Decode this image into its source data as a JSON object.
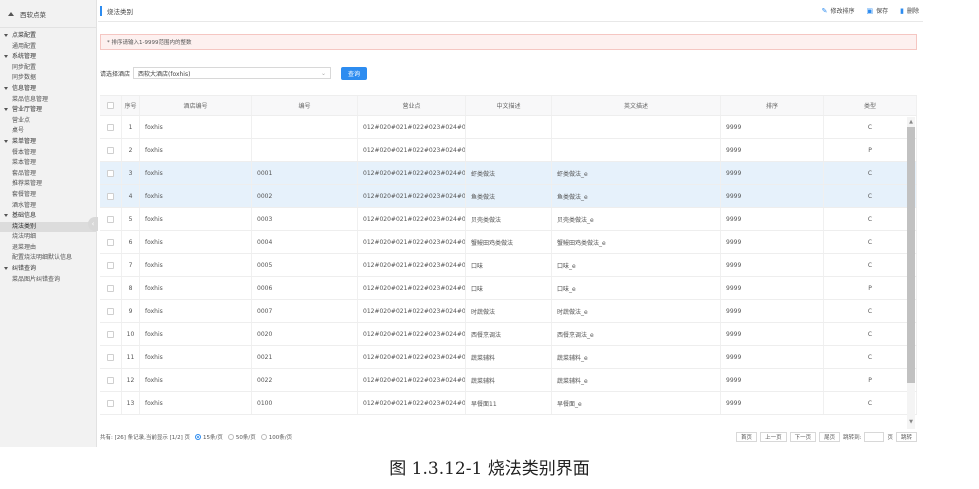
{
  "sidebar": {
    "brand": "西软点菜",
    "items": [
      {
        "label": "点菜配置",
        "type": "group"
      },
      {
        "label": "通用配置",
        "type": "sub"
      },
      {
        "label": "系统管理",
        "type": "group"
      },
      {
        "label": "同步配置",
        "type": "sub"
      },
      {
        "label": "同步数据",
        "type": "sub"
      },
      {
        "label": "信息管理",
        "type": "group"
      },
      {
        "label": "菜品信息管理",
        "type": "sub"
      },
      {
        "label": "营业厅管理",
        "type": "group"
      },
      {
        "label": "营业点",
        "type": "sub"
      },
      {
        "label": "桌号",
        "type": "sub"
      },
      {
        "label": "菜单管理",
        "type": "group"
      },
      {
        "label": "餐本管理",
        "type": "sub"
      },
      {
        "label": "菜本管理",
        "type": "sub"
      },
      {
        "label": "套品管理",
        "type": "sub"
      },
      {
        "label": "推荐菜管理",
        "type": "sub"
      },
      {
        "label": "套餐管理",
        "type": "sub"
      },
      {
        "label": "酒水管理",
        "type": "sub"
      },
      {
        "label": "基础信息",
        "type": "group"
      },
      {
        "label": "烧法类别",
        "type": "sub",
        "active": true
      },
      {
        "label": "烧法明细",
        "type": "sub"
      },
      {
        "label": "退菜理由",
        "type": "sub"
      },
      {
        "label": "配置烧法明细默认信息",
        "type": "sub"
      },
      {
        "label": "纠错查询",
        "type": "group"
      },
      {
        "label": "菜品图片纠错查询",
        "type": "sub"
      }
    ]
  },
  "header": {
    "title": "烧法类别",
    "actions": {
      "sort": "修改排序",
      "save": "保存",
      "delete": "删除"
    }
  },
  "notice": "* 排序请输入1-9999范围内的整数",
  "filter": {
    "label": "请选择酒店",
    "selected": "西软大酒店(foxhis)",
    "query": "查询"
  },
  "table": {
    "columns": [
      "序号",
      "酒店编号",
      "编号",
      "营业点",
      "中文描述",
      "英文描述",
      "排序",
      "类型"
    ],
    "rows": [
      {
        "no": "1",
        "hotel": "foxhis",
        "code": "",
        "point": "012#020#021#022#023#024#02...",
        "cn": "",
        "en": "",
        "sort": "9999",
        "type": "C",
        "hl": false
      },
      {
        "no": "2",
        "hotel": "foxhis",
        "code": "",
        "point": "012#020#021#022#023#024#02...",
        "cn": "",
        "en": "",
        "sort": "9999",
        "type": "P",
        "hl": false
      },
      {
        "no": "3",
        "hotel": "foxhis",
        "code": "0001",
        "point": "012#020#021#022#023#024#02...",
        "cn": "虾类做法",
        "en": "虾类做法_e",
        "sort": "9999",
        "type": "C",
        "hl": true
      },
      {
        "no": "4",
        "hotel": "foxhis",
        "code": "0002",
        "point": "012#020#021#022#023#024#02...",
        "cn": "鱼类做法",
        "en": "鱼类做法_e",
        "sort": "9999",
        "type": "C",
        "hl": true
      },
      {
        "no": "5",
        "hotel": "foxhis",
        "code": "0003",
        "point": "012#020#021#022#023#024#02...",
        "cn": "贝壳类做法",
        "en": "贝壳类做法_e",
        "sort": "9999",
        "type": "C",
        "hl": false
      },
      {
        "no": "6",
        "hotel": "foxhis",
        "code": "0004",
        "point": "012#020#021#022#023#024#02...",
        "cn": "蟹鳗田鸡类做法",
        "en": "蟹鳗田鸡类做法_e",
        "sort": "9999",
        "type": "C",
        "hl": false
      },
      {
        "no": "7",
        "hotel": "foxhis",
        "code": "0005",
        "point": "012#020#021#022#023#024#02...",
        "cn": "口味",
        "en": "口味_e",
        "sort": "9999",
        "type": "C",
        "hl": false
      },
      {
        "no": "8",
        "hotel": "foxhis",
        "code": "0006",
        "point": "012#020#021#022#023#024#02...",
        "cn": "口味",
        "en": "口味_e",
        "sort": "9999",
        "type": "P",
        "hl": false
      },
      {
        "no": "9",
        "hotel": "foxhis",
        "code": "0007",
        "point": "012#020#021#022#023#024#02...",
        "cn": "时蔬做法",
        "en": "时蔬做法_e",
        "sort": "9999",
        "type": "C",
        "hl": false
      },
      {
        "no": "10",
        "hotel": "foxhis",
        "code": "0020",
        "point": "012#020#021#022#023#024#02...",
        "cn": "西餐烹调法",
        "en": "西餐烹调法_e",
        "sort": "9999",
        "type": "C",
        "hl": false
      },
      {
        "no": "11",
        "hotel": "foxhis",
        "code": "0021",
        "point": "012#020#021#022#023#024#02...",
        "cn": "蔬菜辅料",
        "en": "蔬菜辅料_e",
        "sort": "9999",
        "type": "C",
        "hl": false
      },
      {
        "no": "12",
        "hotel": "foxhis",
        "code": "0022",
        "point": "012#020#021#022#023#024#02...",
        "cn": "蔬菜辅料",
        "en": "蔬菜辅料_e",
        "sort": "9999",
        "type": "P",
        "hl": false
      },
      {
        "no": "13",
        "hotel": "foxhis",
        "code": "0100",
        "point": "012#020#021#022#023#024#02...",
        "cn": "早餐面11",
        "en": "早餐面_e",
        "sort": "9999",
        "type": "C",
        "hl": false
      }
    ]
  },
  "footer": {
    "summary": "共有: [26] 条记录,当前显示 [1/2] 页",
    "page_sizes": [
      {
        "label": "15条/页",
        "selected": true
      },
      {
        "label": "50条/页",
        "selected": false
      },
      {
        "label": "100条/页",
        "selected": false
      }
    ],
    "pager": {
      "first": "首页",
      "prev": "上一页",
      "next": "下一页",
      "last": "尾页",
      "jump_to": "跳转到:",
      "page_unit": "页",
      "jump": "跳转"
    }
  },
  "caption": "图 1.3.12-1 烧法类别界面",
  "colors": {
    "accent": "#2d8cf0",
    "highlight_row": "#e6f1fb",
    "notice_bg": "#fdf0ef"
  }
}
